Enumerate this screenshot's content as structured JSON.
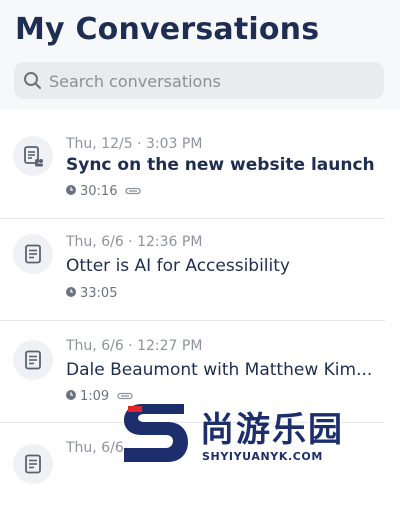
{
  "header": {
    "title": "My Conversations",
    "search_placeholder": "Search conversations",
    "search_icon": "search-icon"
  },
  "conversations": [
    {
      "date": "Thu, 12/5 · 3:03 PM",
      "title": "Sync on the new website launch",
      "duration": "30:16",
      "attachment": true,
      "icon": "shared-notes-icon",
      "bold": true
    },
    {
      "date": "Thu, 6/6 · 12:36 PM",
      "title": "Otter is AI for Accessibility",
      "duration": "33:05",
      "attachment": false,
      "icon": "notes-icon",
      "bold": false
    },
    {
      "date": "Thu, 6/6 · 12:27 PM",
      "title": "Dale Beaumont with Matthew Kim...",
      "duration": "1:09",
      "attachment": true,
      "icon": "notes-icon",
      "bold": false
    },
    {
      "date": "Thu, 6/6",
      "title": "",
      "duration": "",
      "attachment": false,
      "icon": "notes-icon",
      "bold": false
    }
  ],
  "watermark": {
    "text": "尚游乐园",
    "url": "SHYIYUANYK.COM"
  },
  "colors": {
    "title": "#1e2d52",
    "muted": "#8e939c",
    "search_bg": "#e9ebee",
    "watermark_blue": "#1c2e6b",
    "watermark_red": "#e2242c"
  }
}
